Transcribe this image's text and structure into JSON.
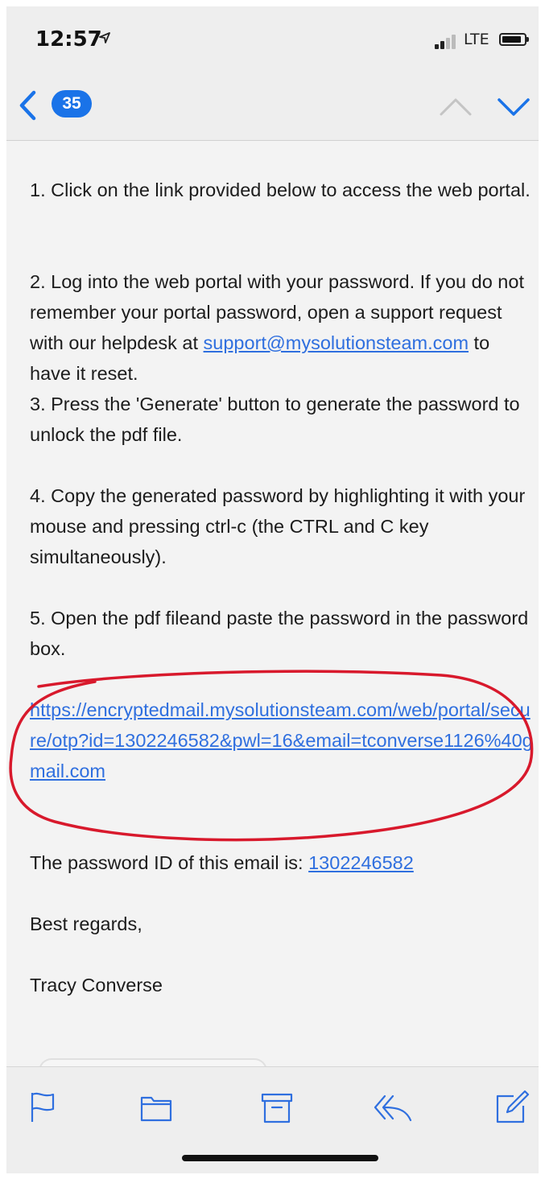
{
  "status_bar": {
    "time": "12:57",
    "carrier": "LTE"
  },
  "nav": {
    "unread_count": "35"
  },
  "email": {
    "step1": "1. Click on the link provided below to access the web portal.",
    "step2_before": "2. Log into the web portal with your password. If you do not remember your portal password, open a support request with our helpdesk at ",
    "support_email": "support@mysolutionsteam.com",
    "step2_after": " to have it reset.",
    "step3": "3. Press the 'Generate' button to generate the password to unlock the pdf file.",
    "step4": "4. Copy the generated password by highlighting it with your mouse and pressing ctrl-c (the CTRL and C key simultaneously).",
    "step5": "5. Open the pdf fileand paste the password in the password box.",
    "portal_link": "https://encryptedmail.mysolutionsteam.com/web/portal/secure/otp?id=1302246582&pwl=16&email=tconverse1126%40gmail.com",
    "password_id_label": "The password ID of this email is: ",
    "password_id": "1302246582",
    "closing": "Best regards,",
    "signature": "Tracy Converse"
  },
  "colors": {
    "accent": "#1a73e8",
    "link": "#2f6fdf",
    "annotation": "#d8192c"
  },
  "toolbar_icons": [
    "flag-icon",
    "folder-icon",
    "archive-icon",
    "reply-icon",
    "compose-icon"
  ]
}
